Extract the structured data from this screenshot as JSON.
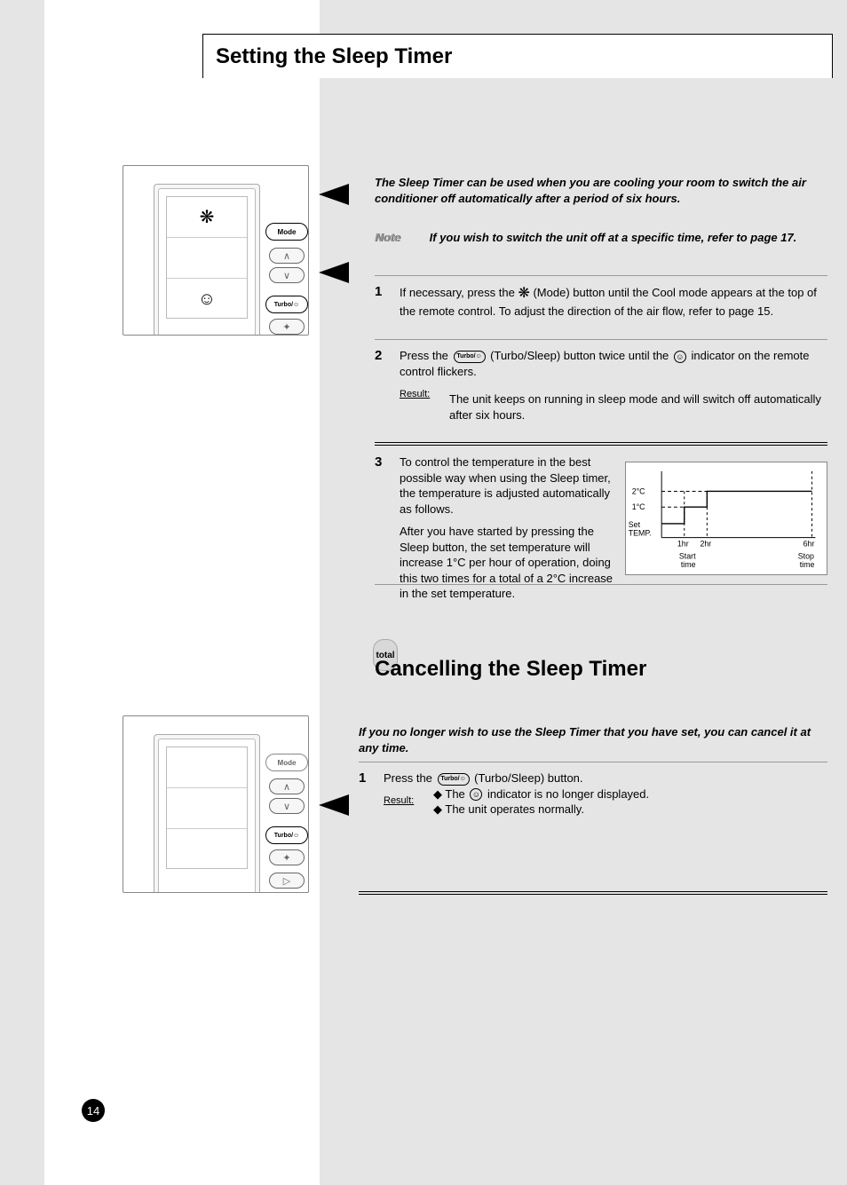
{
  "header": {
    "title": "Setting the Sleep Timer"
  },
  "intro": "The Sleep Timer can be used when you are cooling your room to switch the air conditioner off automatically after a period of six hours.",
  "note": {
    "label": "Note",
    "text": "If you wish to switch the unit off at a specific time, refer to page 17."
  },
  "steps": {
    "s1_num": "1",
    "s1_a": "If necessary, press the ",
    "s1_b": " (Mode) button until the Cool mode appears at the top of the remote control. To adjust the direction of the air flow, refer to page 15.",
    "s2_num": "2",
    "s2_a": "Press the ",
    "s2_b": " (Turbo/Sleep) button twice until the ",
    "s2_c": " indicator on the remote control flickers.",
    "result_label": "Result:",
    "s2_result": "The unit keeps on running in sleep mode and will switch off automatically after six hours.",
    "s3_num": "3",
    "s3_a": "To control the temperature in the best possible way when using the Sleep timer, the temperature is adjusted automatically as follows.",
    "s3_b": "After you have started by pressing the Sleep button, the set temperature will increase 1°C per hour of operation, doing this two times for a total of a 2°C increase in the set temperature."
  },
  "chart_data": {
    "type": "line",
    "title": "",
    "xlabel": "",
    "ylabel": "Set TEMP.",
    "x_ticks": [
      "1hr",
      "2hr",
      "6hr"
    ],
    "y_ticks": [
      "1°C",
      "2°C"
    ],
    "start_label": "Start time",
    "stop_label": "Stop time",
    "series": [
      {
        "name": "set_temp_offset",
        "points": [
          [
            0,
            0
          ],
          [
            1,
            1
          ],
          [
            2,
            2
          ],
          [
            6,
            2
          ]
        ]
      }
    ],
    "xlim": [
      0,
      6
    ],
    "ylim": [
      0,
      2.5
    ]
  },
  "section2": {
    "total_label": "total",
    "title": "Cancelling the Sleep Timer",
    "intro": "If you no longer wish to use the Sleep Timer that you have set, you can cancel it at any time.",
    "s1_num": "1",
    "s1_a": "Press the ",
    "s1_b": " (Turbo/Sleep) button.",
    "result_label": "Result:",
    "s1_res_a": "◆ The ",
    "s1_res_b": " indicator is no longer displayed.",
    "s1_res_c": "◆ The unit operates normally."
  },
  "icons": {
    "mode": "Mode",
    "turbo": "Turbo/☺",
    "sleep": "☺",
    "snow": "❋"
  },
  "page_number": "14"
}
